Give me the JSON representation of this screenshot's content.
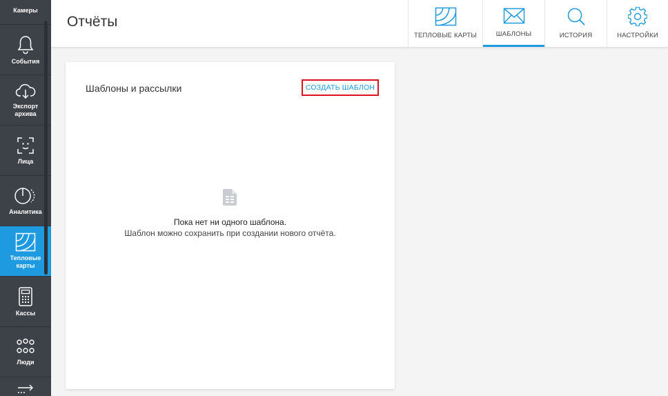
{
  "sidebar": {
    "items": [
      {
        "label": "Камеры",
        "icon": "camera-icon"
      },
      {
        "label": "События",
        "icon": "bell-icon"
      },
      {
        "label": "Экспорт архива",
        "icon": "cloud-download-icon"
      },
      {
        "label": "Лица",
        "icon": "face-frame-icon"
      },
      {
        "label": "Аналитика",
        "icon": "analytics-circle-icon"
      },
      {
        "label": "Тепловые карты",
        "icon": "heatmap-icon",
        "active": true
      },
      {
        "label": "Кассы",
        "icon": "cash-register-icon"
      },
      {
        "label": "Люди",
        "icon": "people-icon"
      },
      {
        "label": "",
        "icon": "arrows-icon"
      }
    ]
  },
  "header": {
    "title": "Отчёты",
    "tabs": [
      {
        "label": "ТЕПЛОВЫЕ КАРТЫ",
        "icon": "heatmap-icon"
      },
      {
        "label": "ШАБЛОНЫ",
        "icon": "envelope-icon",
        "active": true
      },
      {
        "label": "ИСТОРИЯ",
        "icon": "search-icon"
      },
      {
        "label": "НАСТРОЙКИ",
        "icon": "gear-icon"
      }
    ]
  },
  "card": {
    "title": "Шаблоны и рассылки",
    "create_button": "СОЗДАТЬ ШАБЛОН",
    "empty_title": "Пока нет ни одного шаблона.",
    "empty_subtitle": "Шаблон можно сохранить при создании нового отчёта.",
    "empty_icon": "spreadsheet-document-icon"
  },
  "colors": {
    "accent": "#1e9ae0",
    "sidebar_bg": "#3d4148",
    "highlight_border": "#d9121b"
  }
}
